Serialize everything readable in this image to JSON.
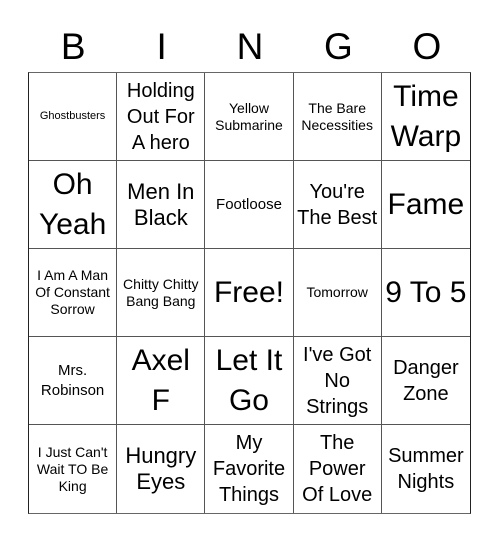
{
  "header": [
    "B",
    "I",
    "N",
    "G",
    "O"
  ],
  "cells": [
    {
      "text": "Ghostbusters",
      "size": "s11"
    },
    {
      "text": "Holding Out For A hero",
      "size": "s20"
    },
    {
      "text": "Yellow Submarine",
      "size": "s13"
    },
    {
      "text": "The Bare Necessities",
      "size": "s13"
    },
    {
      "text": "Time Warp",
      "size": "s30"
    },
    {
      "text": "Oh Yeah",
      "size": "s30"
    },
    {
      "text": "Men In Black",
      "size": "s22"
    },
    {
      "text": "Footloose",
      "size": "s15"
    },
    {
      "text": "You're The Best",
      "size": "s20"
    },
    {
      "text": "Fame",
      "size": "s30"
    },
    {
      "text": "I Am A Man Of Constant Sorrow",
      "size": "s13"
    },
    {
      "text": "Chitty Chitty Bang Bang",
      "size": "s13"
    },
    {
      "text": "Free!",
      "size": "s30"
    },
    {
      "text": "Tomorrow",
      "size": "s13"
    },
    {
      "text": "9 To 5",
      "size": "s30"
    },
    {
      "text": "Mrs. Robinson",
      "size": "s15"
    },
    {
      "text": "Axel F",
      "size": "s30"
    },
    {
      "text": "Let It Go",
      "size": "s30"
    },
    {
      "text": "I've Got No Strings",
      "size": "s20"
    },
    {
      "text": "Danger Zone",
      "size": "s20"
    },
    {
      "text": "I Just Can't Wait TO Be King",
      "size": "s13"
    },
    {
      "text": "Hungry Eyes",
      "size": "s22"
    },
    {
      "text": "My Favorite Things",
      "size": "s20"
    },
    {
      "text": "The Power Of Love",
      "size": "s20"
    },
    {
      "text": "Summer Nights",
      "size": "s20"
    }
  ]
}
